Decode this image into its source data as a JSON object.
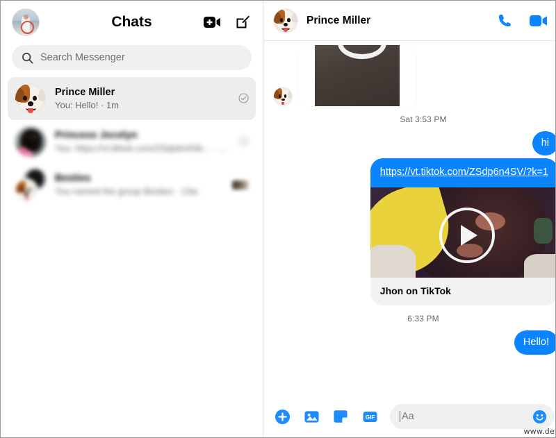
{
  "app": {
    "watermark": "www.deuaq.com"
  },
  "sidebar": {
    "title": "Chats",
    "my_avatar_alt": "beach-photo-avatar",
    "actions": [
      {
        "name": "new-video-call",
        "icon": "video-plus-icon"
      },
      {
        "name": "new-message",
        "icon": "compose-icon"
      }
    ],
    "search": {
      "placeholder": "Search Messenger",
      "value": "",
      "icon": "search-icon"
    },
    "items": [
      {
        "name": "Prince Miller",
        "snippet": "You: Hello! · 1m",
        "active": true,
        "blurred": false,
        "status_icon": "check-circle-icon",
        "avatar": "cartoon-dog"
      },
      {
        "name": "Princess Jocelyn",
        "snippet": "You: https://vt.tiktok.com/ZSdp6n4Sb... · 1d",
        "active": false,
        "blurred": true,
        "status_icon": "check-circle-icon",
        "avatar": "dachshund-flowers"
      },
      {
        "name": "Besties",
        "snippet": "You named the group Besties · 13w",
        "active": false,
        "blurred": true,
        "status_icon": "seen-thumbnail",
        "avatar": "group-dogs"
      }
    ]
  },
  "thread": {
    "title": "Prince Miller",
    "avatar": "cartoon-dog",
    "actions": [
      {
        "name": "audio-call",
        "icon": "phone-icon"
      },
      {
        "name": "video-call",
        "icon": "video-camera-icon"
      },
      {
        "name": "conversation-info",
        "icon": "ellipsis-circle-icon"
      }
    ],
    "messages": [
      {
        "kind": "image",
        "direction": "in",
        "alt": "dark-photo-attachment"
      },
      {
        "kind": "divider",
        "text": "Sat 3:53 PM"
      },
      {
        "kind": "text",
        "direction": "out",
        "text": "hi",
        "status_icon": "check-circle-icon"
      },
      {
        "kind": "link",
        "direction": "out",
        "url": "https://vt.tiktok.com/ZSdp6n4SV/?k=1",
        "preview_title": "Jhon on TikTok",
        "media_alt": "dachshund-video-thumbnail",
        "play_icon": "play-icon",
        "status_icon": "check-circle-icon"
      },
      {
        "kind": "divider",
        "text": "6:33 PM"
      },
      {
        "kind": "text",
        "direction": "out",
        "text": "Hello!",
        "status_icon": "check-circle-icon"
      }
    ],
    "seen_avatar_alt": "cartoon-dog-seen"
  },
  "composer": {
    "placeholder": "Aa",
    "value": "",
    "buttons": [
      {
        "name": "add-attachment",
        "icon": "plus-circle-icon"
      },
      {
        "name": "send-photo",
        "icon": "photo-icon"
      },
      {
        "name": "send-sticker",
        "icon": "sticker-icon"
      },
      {
        "name": "send-gif",
        "icon": "gif-icon",
        "label": "GIF"
      }
    ],
    "emoji_icon": "emoji-smiley-icon",
    "like_icon": "thumbs-up-icon"
  },
  "scrollbar": {
    "up_icon": "scroll-up-arrow",
    "down_icon": "scroll-down-arrow"
  },
  "colors": {
    "brand_blue": "#0a84ff",
    "bubble_out": "#0a84ff",
    "panel_gray": "#f0f0f0",
    "active_row": "#ededed",
    "secondary_text": "#65676b"
  }
}
